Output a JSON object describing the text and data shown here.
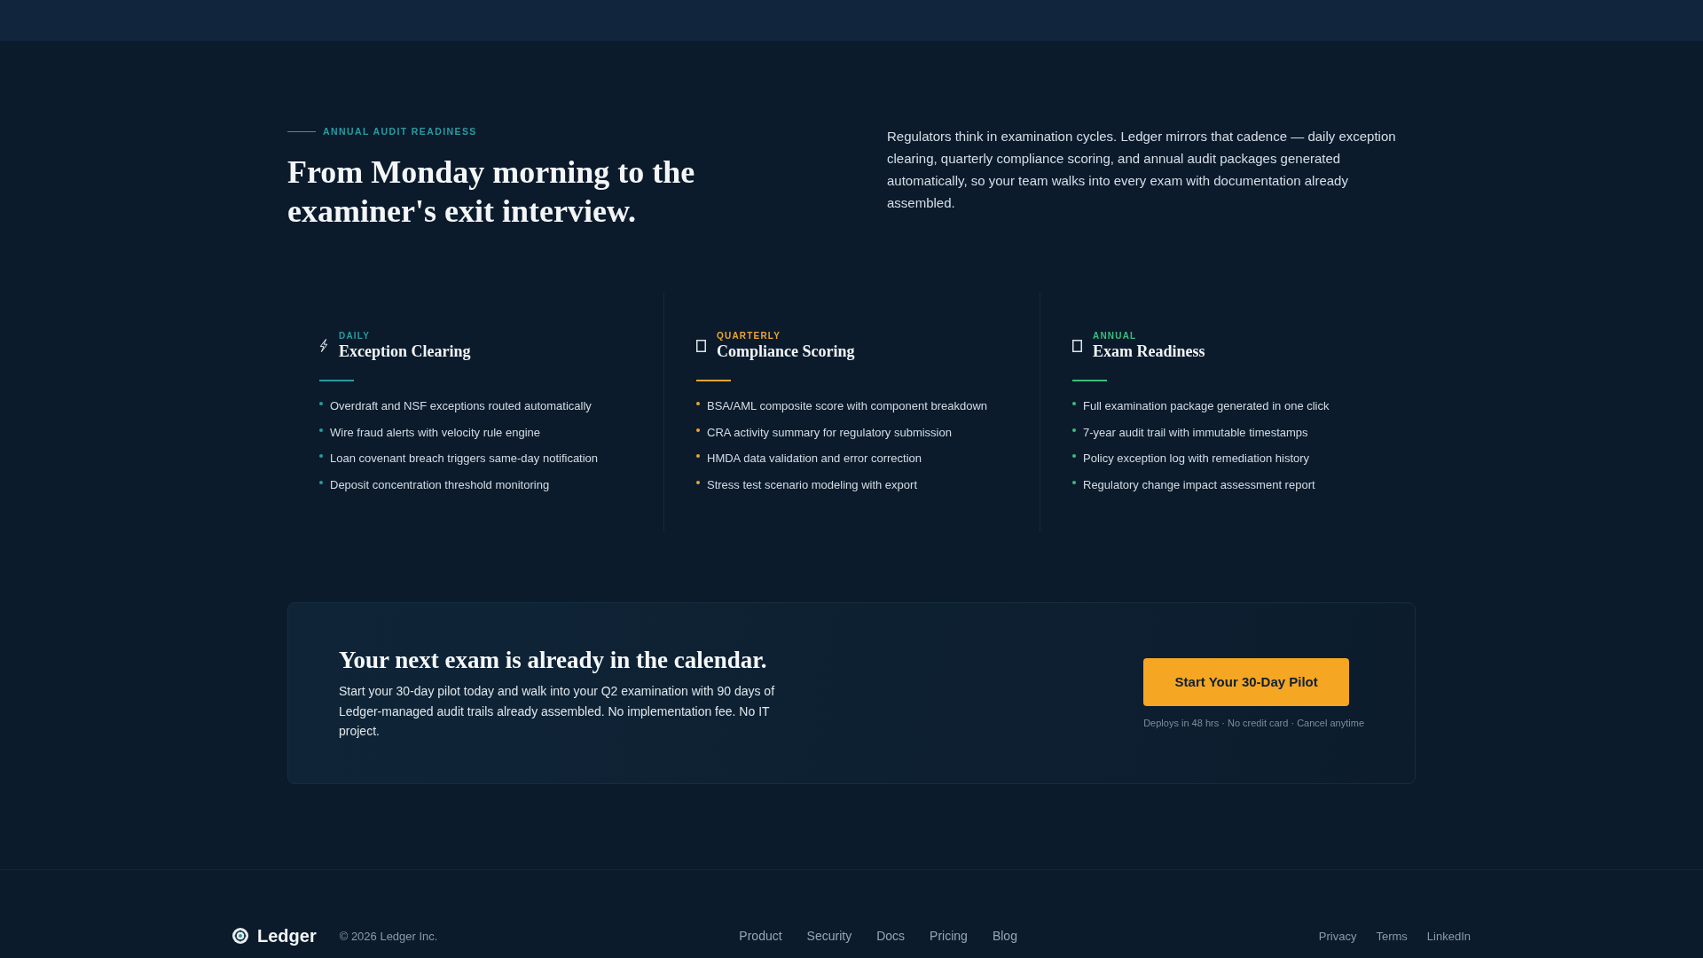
{
  "intro": {
    "eyebrow": "ANNUAL AUDIT READINESS",
    "heading": "From Monday morning to the examiner's exit interview.",
    "description": "Regulators think in examination cycles. Ledger mirrors that cadence — daily exception clearing, quarterly compliance scoring, and annual audit packages generated automatically, so your team walks into every exam with documentation already assembled."
  },
  "cadences": [
    {
      "kind": "bolt",
      "period": "DAILY",
      "title": "Exception Clearing",
      "color": "#2a9ba0",
      "items": [
        "Overdraft and NSF exceptions routed automatically",
        "Wire fraud alerts with velocity rule engine",
        "Loan covenant breach triggers same-day notification",
        "Deposit concentration threshold monitoring"
      ]
    },
    {
      "kind": "box",
      "period": "QUARTERLY",
      "title": "Compliance Scoring",
      "color": "#eda433",
      "items": [
        "BSA/AML composite score with component breakdown",
        "CRA activity summary for regulatory submission",
        "HMDA data validation and error correction",
        "Stress test scenario modeling with export"
      ]
    },
    {
      "kind": "box",
      "period": "ANNUAL",
      "title": "Exam Readiness",
      "color": "#3dbd7d",
      "items": [
        "Full examination package generated in one click",
        "7-year audit trail with immutable timestamps",
        "Policy exception log with remediation history",
        "Regulatory change impact assessment report"
      ]
    }
  ],
  "cta": {
    "title": "Your next exam is already in the calendar.",
    "text": "Start your 30-day pilot today and walk into your Q2 examination with 90 days of Ledger-managed audit trails already assembled. No implementation fee. No IT project.",
    "button": "Start Your 30-Day Pilot",
    "note": "Deploys in 48 hrs · No credit card · Cancel anytime"
  },
  "footer": {
    "brand": "Ledger",
    "copyright": "© 2026 Ledger Inc.",
    "nav": [
      "Product",
      "Security",
      "Docs",
      "Pricing",
      "Blog"
    ],
    "legal": [
      "Privacy",
      "Terms",
      "LinkedIn"
    ]
  }
}
